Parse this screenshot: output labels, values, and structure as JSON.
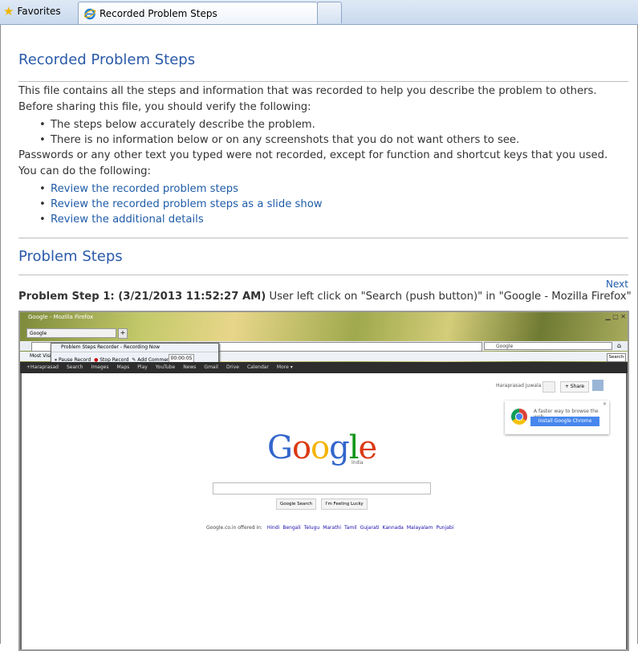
{
  "browser": {
    "favorites_label": "Favorites",
    "tab_title": "Recorded Problem Steps"
  },
  "page": {
    "title": "Recorded Problem Steps",
    "intro_line1": "This file contains all the steps and information that was recorded to help you describe the problem to others.",
    "intro_line2": "Before sharing this file, you should verify the following:",
    "verify_items": [
      "The steps below accurately describe the problem.",
      "There is no information below or on any screenshots that you do not want others to see."
    ],
    "passwords_note": "Passwords or any other text you typed were not recorded, except for function and shortcut keys that you used.",
    "you_can": "You can do the following:",
    "action_links": [
      "Review the recorded problem steps",
      "Review the recorded problem steps as a slide show",
      "Review the additional details"
    ],
    "section_title": "Problem Steps",
    "next_link": "Next",
    "step_label": "Problem Step 1: (3/21/2013 11:52:27 AM)",
    "step_desc": "User left click on \"Search (push button)\" in \"Google - Mozilla Firefox\""
  },
  "screenshot": {
    "window_title": "Google - Mozilla Firefox",
    "tab_label": "Google",
    "firefox_search_placeholder": "Google",
    "bookmarks_label": "Most Visited",
    "search_tooltip": "Search",
    "psr_title": "Problem Steps Recorder - Recording Now",
    "psr_pause": "Pause Record",
    "psr_stop": "Stop Record",
    "psr_comment": "Add Comment",
    "psr_timer": "00:00:05",
    "gbar_items": [
      "+Haraprasad",
      "Search",
      "Images",
      "Maps",
      "Play",
      "YouTube",
      "News",
      "Gmail",
      "Drive",
      "Calendar",
      "More ▾"
    ],
    "user_name": "Haraprasad Juwala",
    "share_label": "+ Share",
    "chrome_msg": "A faster way to browse the web",
    "chrome_btn": "Install Google Chrome",
    "google_logo": [
      "G",
      "o",
      "o",
      "g",
      "l",
      "e"
    ],
    "google_sub": "India",
    "google_search_btn": "Google Search",
    "lucky_btn": "I'm Feeling Lucky",
    "offered_in": "Google.co.in offered in:",
    "languages": [
      "Hindi",
      "Bengali",
      "Telugu",
      "Marathi",
      "Tamil",
      "Gujarati",
      "Kannada",
      "Malayalam",
      "Punjabi"
    ],
    "logo_colors": [
      "#3366cc",
      "#dc3912",
      "#f4b400",
      "#3366cc",
      "#109618",
      "#dc3912"
    ]
  }
}
